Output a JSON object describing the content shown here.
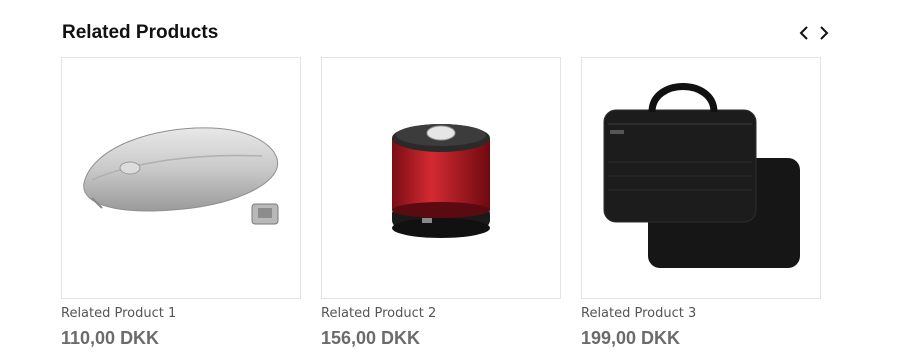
{
  "section": {
    "title": "Related Products"
  },
  "nav": {
    "prev_icon": "chevron-left-icon",
    "next_icon": "chevron-right-icon"
  },
  "products": [
    {
      "name": "Related Product 1",
      "price": "110,00 DKK",
      "image": "wireless-mouse"
    },
    {
      "name": "Related Product 2",
      "price": "156,00 DKK",
      "image": "red-bluetooth-speaker"
    },
    {
      "name": "Related Product 3",
      "price": "199,00 DKK",
      "image": "black-laptop-sleeve"
    }
  ]
}
